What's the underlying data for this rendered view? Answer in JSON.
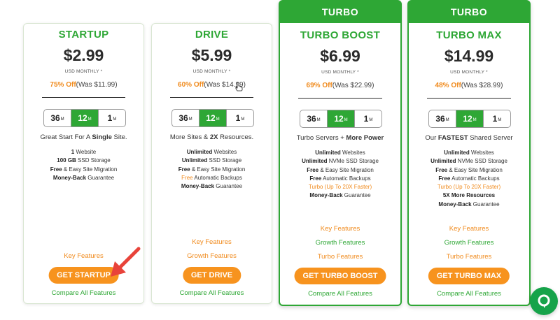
{
  "plans": [
    {
      "ribbon": "",
      "name": "STARTUP",
      "price": "$2.99",
      "price_note": "USD MONTHLY *",
      "discount_pct": "75% Off",
      "was": "(Was $11.99)",
      "terms": [
        {
          "num": "36",
          "unit": "M"
        },
        {
          "num": "12",
          "unit": "M"
        },
        {
          "num": "1",
          "unit": "M"
        }
      ],
      "active_term": "12",
      "tagline_pre": "Great Start For A ",
      "tagline_bold": "Single",
      "tagline_post": " Site.",
      "features": [
        {
          "bold": "1",
          "text": " Website"
        },
        {
          "bold": "100 GB",
          "text": " SSD Storage"
        },
        {
          "bold": "Free",
          "text": " & Easy Site Migration"
        },
        {
          "bold": "Money-Back",
          "text": " Guarantee"
        }
      ],
      "links": [
        "Key Features"
      ],
      "cta": "GET STARTUP",
      "compare": "Compare All Features"
    },
    {
      "ribbon": "",
      "name": "DRIVE",
      "price": "$5.99",
      "price_note": "USD MONTHLY *",
      "discount_pct": "60% Off",
      "was": "(Was $14.99)",
      "terms": [
        {
          "num": "36",
          "unit": "M"
        },
        {
          "num": "12",
          "unit": "M"
        },
        {
          "num": "1",
          "unit": "M"
        }
      ],
      "active_term": "12",
      "tagline_pre": "More Sites & ",
      "tagline_bold": "2X",
      "tagline_post": " Resources.",
      "features": [
        {
          "bold": "Unlimited",
          "text": " Websites"
        },
        {
          "bold": "Unlimited",
          "text": " SSD Storage"
        },
        {
          "bold": "Free",
          "text": " & Easy Site Migration"
        },
        {
          "orange": "Free",
          "text": " Automatic Backups"
        },
        {
          "bold": "Money-Back",
          "text": " Guarantee"
        }
      ],
      "links": [
        "Key Features",
        "Growth Features"
      ],
      "cta": "GET DRIVE",
      "compare": "Compare All Features"
    },
    {
      "ribbon": "TURBO",
      "name": "TURBO BOOST",
      "price": "$6.99",
      "price_note": "USD MONTHLY *",
      "discount_pct": "69% Off",
      "was": "(Was $22.99)",
      "terms": [
        {
          "num": "36",
          "unit": "M"
        },
        {
          "num": "12",
          "unit": "M"
        },
        {
          "num": "1",
          "unit": "M"
        }
      ],
      "active_term": "12",
      "tagline_pre": "Turbo Servers + ",
      "tagline_bold": "More Power",
      "tagline_post": "",
      "features": [
        {
          "bold": "Unlimited",
          "text": " Websites"
        },
        {
          "bold": "Unlimited",
          "text": " NVMe SSD Storage"
        },
        {
          "bold": "Free",
          "text": " & Easy Site Migration"
        },
        {
          "bold": "Free",
          "text": " Automatic Backups"
        },
        {
          "orange": "Turbo (Up To 20X Faster)",
          "text": ""
        },
        {
          "bold": "Money-Back",
          "text": " Guarantee"
        }
      ],
      "links": [
        "Key Features",
        "Growth Features",
        "Turbo Features"
      ],
      "cta": "GET TURBO BOOST",
      "compare": "Compare All Features"
    },
    {
      "ribbon": "TURBO",
      "name": "TURBO MAX",
      "price": "$14.99",
      "price_note": "USD MONTHLY *",
      "discount_pct": "48% Off",
      "was": "(Was $28.99)",
      "terms": [
        {
          "num": "36",
          "unit": "M"
        },
        {
          "num": "12",
          "unit": "M"
        },
        {
          "num": "1",
          "unit": "M"
        }
      ],
      "active_term": "12",
      "tagline_pre": "Our ",
      "tagline_bold": "FASTEST",
      "tagline_post": " Shared Server",
      "features": [
        {
          "bold": "Unlimited",
          "text": " Websites"
        },
        {
          "bold": "Unlimited",
          "text": " NVMe SSD Storage"
        },
        {
          "bold": "Free",
          "text": " & Easy Site Migration"
        },
        {
          "bold": "Free",
          "text": " Automatic Backups"
        },
        {
          "orange": "Turbo (Up To 20X Faster)",
          "text": ""
        },
        {
          "orange": "5X More Resources",
          "text": ""
        },
        {
          "bold": "Money-Back",
          "text": " Guarantee"
        }
      ],
      "links": [
        "Key Features",
        "Growth Features",
        "Turbo Features"
      ],
      "cta": "GET TURBO MAX",
      "compare": "Compare All Features"
    }
  ],
  "colors": {
    "brand_green": "#2ea735",
    "accent_orange": "#f7931e",
    "annotation_red": "#e8433a"
  },
  "icons": {
    "annotation": "red-arrow-icon",
    "cursor": "hand-cursor-icon",
    "chat": "chat-icon"
  }
}
